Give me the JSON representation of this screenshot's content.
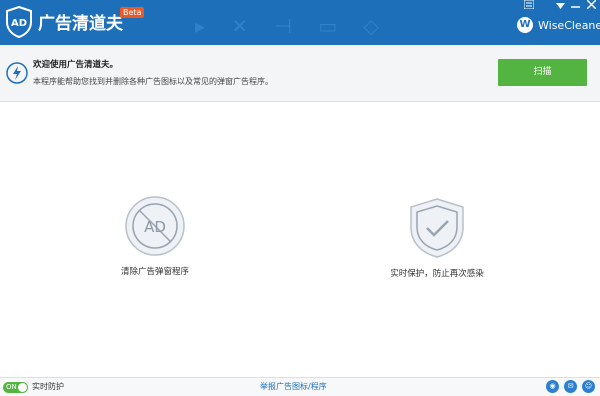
{
  "app": {
    "title": "广告清道夫",
    "badge": "Beta",
    "brand_badge": "W",
    "brand_name": "WiseCleaner"
  },
  "window_controls": {
    "menu_icon": "list-icon",
    "dropdown_icon": "chevron-down-icon",
    "minimize_icon": "minus-icon",
    "close_icon": "close-icon"
  },
  "info": {
    "welcome": "欢迎使用广告清道夫。",
    "description": "本程序能帮助您找到并删除各种广告图标以及常见的弹窗广告程序。",
    "scan_button": "扫描"
  },
  "features": [
    {
      "label": "清除广告弹窗程序",
      "icon": "ad-block-icon"
    },
    {
      "label": "实时保护，防止再次感染",
      "icon": "shield-check-icon"
    }
  ],
  "footer": {
    "toggle_state": "ON",
    "realtime_label": "实时防护",
    "report_link": "举报广告图标/程序"
  },
  "colors": {
    "titlebar": "#1d6fba",
    "accent_green": "#54b441"
  }
}
